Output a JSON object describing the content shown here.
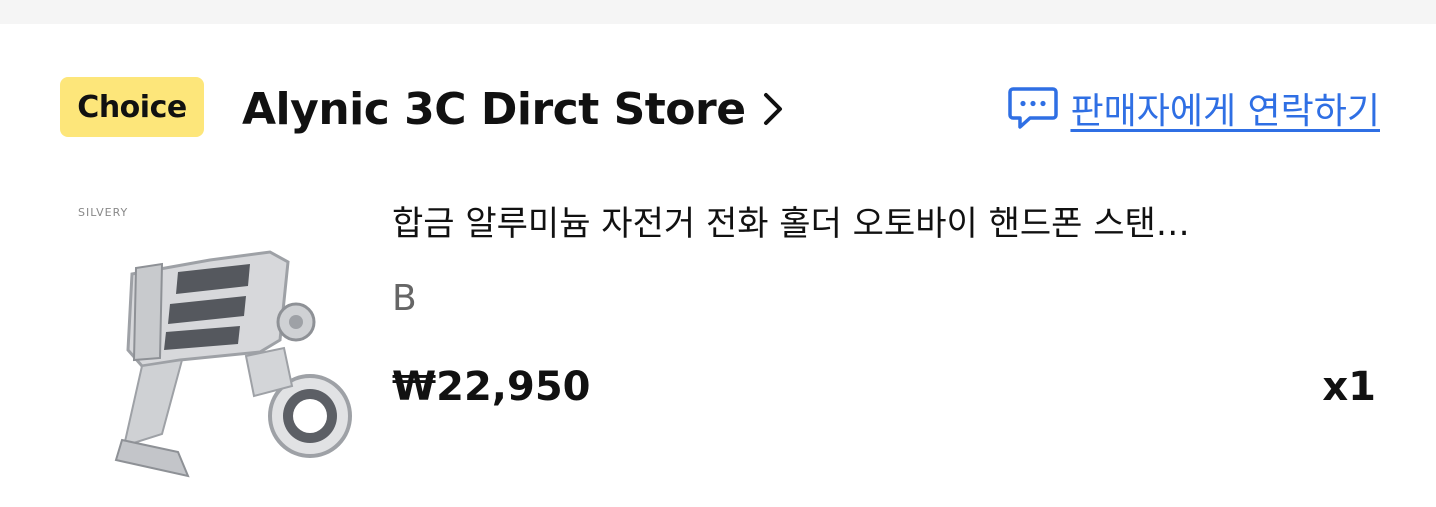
{
  "store": {
    "badge": "Choice",
    "name": "Alynic 3C Dirct Store",
    "contact_label": "판매자에게 연락하기",
    "accent_color": "#2f6fe4",
    "badge_color": "#fde67a"
  },
  "item": {
    "image_caption": "SILVERY",
    "title": "합금 알루미늄 자전거 전화 홀더 오토바이 핸드폰 스탠…",
    "variant": "B",
    "price": "₩22,950",
    "quantity": "x1"
  },
  "icons": {
    "store_chevron": "chevron-right-icon",
    "contact": "chat-bubble-icon"
  }
}
